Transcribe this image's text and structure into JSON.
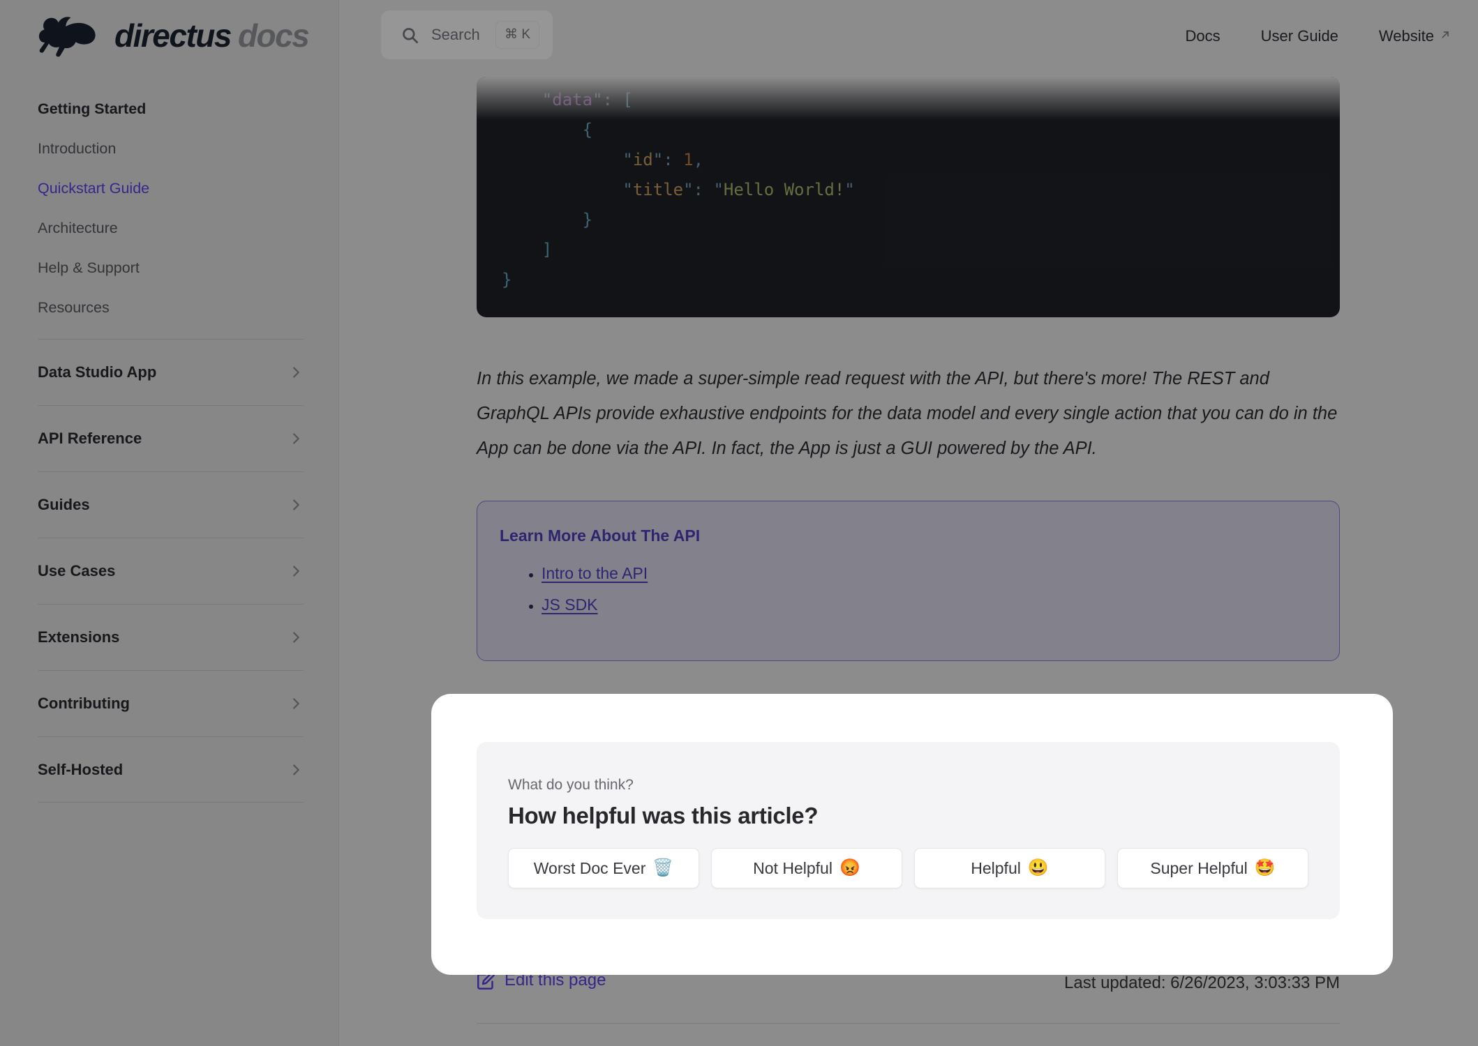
{
  "brand": {
    "name": "directus",
    "suffix": "docs"
  },
  "topbar": {
    "search_label": "Search",
    "search_kbd": "⌘ K",
    "nav": [
      {
        "label": "Docs",
        "external": false
      },
      {
        "label": "User Guide",
        "external": false
      },
      {
        "label": "Website",
        "external": true
      }
    ]
  },
  "sidebar": {
    "top_group": {
      "title": "Getting Started",
      "items": [
        {
          "label": "Introduction",
          "active": false
        },
        {
          "label": "Quickstart Guide",
          "active": true
        },
        {
          "label": "Architecture",
          "active": false
        },
        {
          "label": "Help & Support",
          "active": false
        },
        {
          "label": "Resources",
          "active": false
        }
      ]
    },
    "groups": [
      {
        "label": "Data Studio App"
      },
      {
        "label": "API Reference"
      },
      {
        "label": "Guides"
      },
      {
        "label": "Use Cases"
      },
      {
        "label": "Extensions"
      },
      {
        "label": "Contributing"
      },
      {
        "label": "Self-Hosted"
      }
    ]
  },
  "content": {
    "code": {
      "lines": [
        [
          {
            "c": "sp",
            "v": "    "
          },
          {
            "c": "q",
            "v": "\""
          },
          {
            "c": "kp",
            "v": "data"
          },
          {
            "c": "q",
            "v": "\""
          },
          {
            "c": "p",
            "v": ": "
          },
          {
            "c": "b",
            "v": "["
          }
        ],
        [
          {
            "c": "sp",
            "v": "        "
          },
          {
            "c": "b",
            "v": "{"
          }
        ],
        [
          {
            "c": "sp",
            "v": "            "
          },
          {
            "c": "q",
            "v": "\""
          },
          {
            "c": "ko",
            "v": "id"
          },
          {
            "c": "q",
            "v": "\""
          },
          {
            "c": "p",
            "v": ": "
          },
          {
            "c": "n",
            "v": "1"
          },
          {
            "c": "p",
            "v": ","
          }
        ],
        [
          {
            "c": "sp",
            "v": "            "
          },
          {
            "c": "q",
            "v": "\""
          },
          {
            "c": "ko",
            "v": "title"
          },
          {
            "c": "q",
            "v": "\""
          },
          {
            "c": "p",
            "v": ": "
          },
          {
            "c": "q",
            "v": "\""
          },
          {
            "c": "s",
            "v": "Hello World!"
          },
          {
            "c": "q",
            "v": "\""
          }
        ],
        [
          {
            "c": "sp",
            "v": "        "
          },
          {
            "c": "b",
            "v": "}"
          }
        ],
        [
          {
            "c": "sp",
            "v": "    "
          },
          {
            "c": "b",
            "v": "]"
          }
        ],
        [
          {
            "c": "b",
            "v": "}"
          }
        ]
      ]
    },
    "paragraph": "In this example, we made a super-simple read request with the API, but there's more! The REST and GraphQL APIs provide exhaustive endpoints for the data model and every single action that you can do in the App can be done via the API. In fact, the App is just a GUI powered by the API.",
    "callout": {
      "title": "Learn More About The API",
      "links": [
        "Intro to the API",
        "JS SDK"
      ]
    },
    "footer": {
      "edit_label": "Edit this page",
      "last_updated": "Last updated: 6/26/2023, 3:03:33 PM"
    }
  },
  "feedback": {
    "kicker": "What do you think?",
    "question": "How helpful was this article?",
    "buttons": [
      {
        "label": "Worst Doc Ever",
        "emoji": "🗑️"
      },
      {
        "label": "Not Helpful",
        "emoji": "😡"
      },
      {
        "label": "Helpful",
        "emoji": "😃"
      },
      {
        "label": "Super Helpful",
        "emoji": "🤩"
      }
    ]
  },
  "colors": {
    "accent": "#6644FF",
    "overlay": "rgba(0,0,0,0.45)",
    "code_bg": "#22242A",
    "callout_bg": "#EFECFF",
    "callout_border": "#8F83E8",
    "callout_ink": "#5246C8",
    "tok_purple": "#C678DD",
    "tok_orange": "#DCAB67",
    "tok_num": "#D2884A",
    "tok_str": "#BCC577",
    "tok_punc": "#84AECB",
    "tok_bracket": "#72B7D4"
  }
}
